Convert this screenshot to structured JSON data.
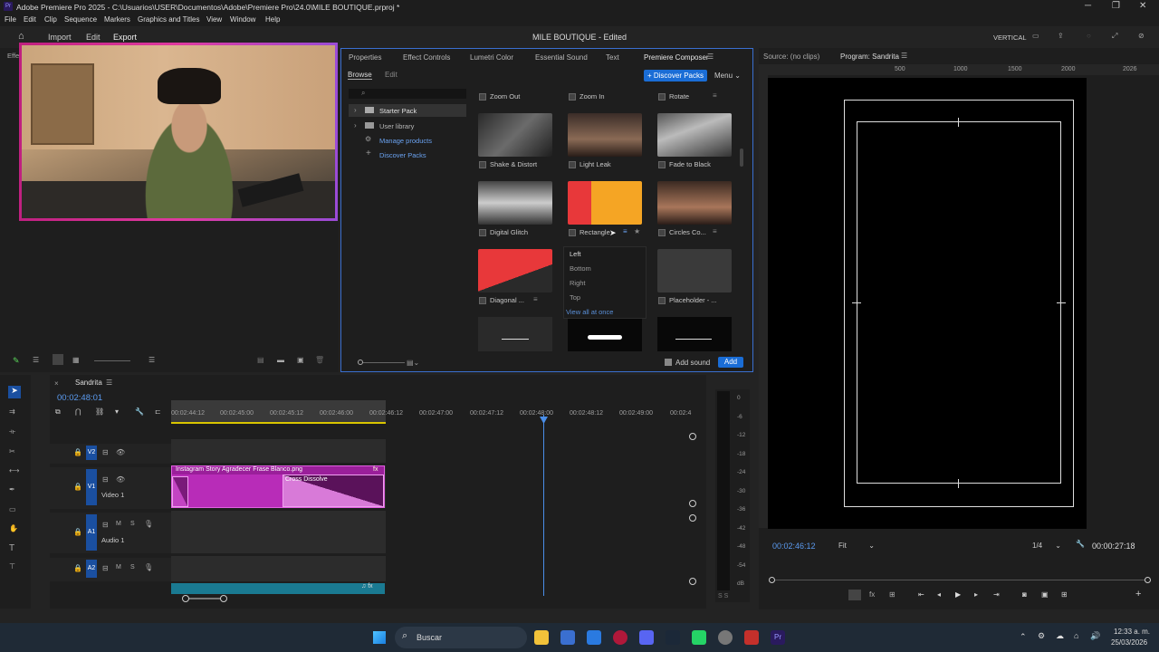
{
  "window": {
    "title": "Adobe Premiere Pro 2025 - C:\\Usuarios\\USER\\Documentos\\Adobe\\Premiere Pro\\24.0\\MILE BOUTIQUE.prproj *"
  },
  "menu": [
    "File",
    "Edit",
    "Clip",
    "Sequence",
    "Markers",
    "Graphics and Titles",
    "View",
    "Window",
    "Help"
  ],
  "header": {
    "nav": [
      "Import",
      "Edit",
      "Export"
    ],
    "project": "MILE BOUTIQUE - Edited",
    "layout": "VERTICAL"
  },
  "panel_tabs": [
    "Properties",
    "Effect Controls",
    "Lumetri Color",
    "Essential Sound",
    "Text",
    "Premiere Composer"
  ],
  "composer": {
    "subtabs": [
      "Browse",
      "Edit"
    ],
    "discover_button": "+ Discover Packs",
    "menu_label": "Menu",
    "tree": [
      {
        "label": "Starter Pack"
      },
      {
        "label": "User library"
      },
      {
        "label": "Manage products"
      },
      {
        "label": "Discover Packs"
      }
    ],
    "presets": [
      {
        "label": "Zoom Out"
      },
      {
        "label": "Zoom In"
      },
      {
        "label": "Rotate"
      },
      {
        "label": "Shake & Distort"
      },
      {
        "label": "Light Leak"
      },
      {
        "label": "Fade to Black"
      },
      {
        "label": "Digital Glitch"
      },
      {
        "label": "Rectangle"
      },
      {
        "label": "Circles Co..."
      },
      {
        "label": "Diagonal ..."
      },
      {
        "label": "Placeholder - ..."
      }
    ],
    "dropdown": [
      "Left",
      "Bottom",
      "Right",
      "Top"
    ],
    "view_all": "View all at once",
    "add_sound": "Add sound",
    "add_button": "Add"
  },
  "program": {
    "source": "Source: (no clips)",
    "program_tab": "Program: Sandrita",
    "ruler": [
      "500",
      "1000",
      "1500",
      "2000",
      "2026"
    ],
    "timecode": "00:02:46:12",
    "fit": "Fit",
    "ratio": "1/4",
    "duration": "00:00:27:18"
  },
  "timeline": {
    "sequence": "Sandrita",
    "timecode": "00:02:48:01",
    "ruler": [
      "00:02:44:12",
      "00:02:45:00",
      "00:02:45:12",
      "00:02:46:00",
      "00:02:46:12",
      "00:02:47:00",
      "00:02:47:12",
      "00:02:48:00",
      "00:02:48:12",
      "00:02:49:00",
      "00:02:4"
    ],
    "tracks": [
      {
        "id": "V2",
        "name": ""
      },
      {
        "id": "V1",
        "name": "Video 1"
      },
      {
        "id": "A1",
        "name": "Audio 1"
      },
      {
        "id": "A2",
        "name": ""
      }
    ],
    "clip_name": "Instagram Story Agradecer Frase Blanco.png",
    "transition": "Cross Dissolve",
    "meter_scale": [
      "0",
      "-6",
      "-12",
      "-18",
      "-24",
      "-30",
      "-36",
      "-42",
      "-48",
      "-54",
      "dB"
    ]
  },
  "taskbar": {
    "search": "Buscar",
    "time": "12:33 a. m.",
    "date": "25/03/2026"
  }
}
